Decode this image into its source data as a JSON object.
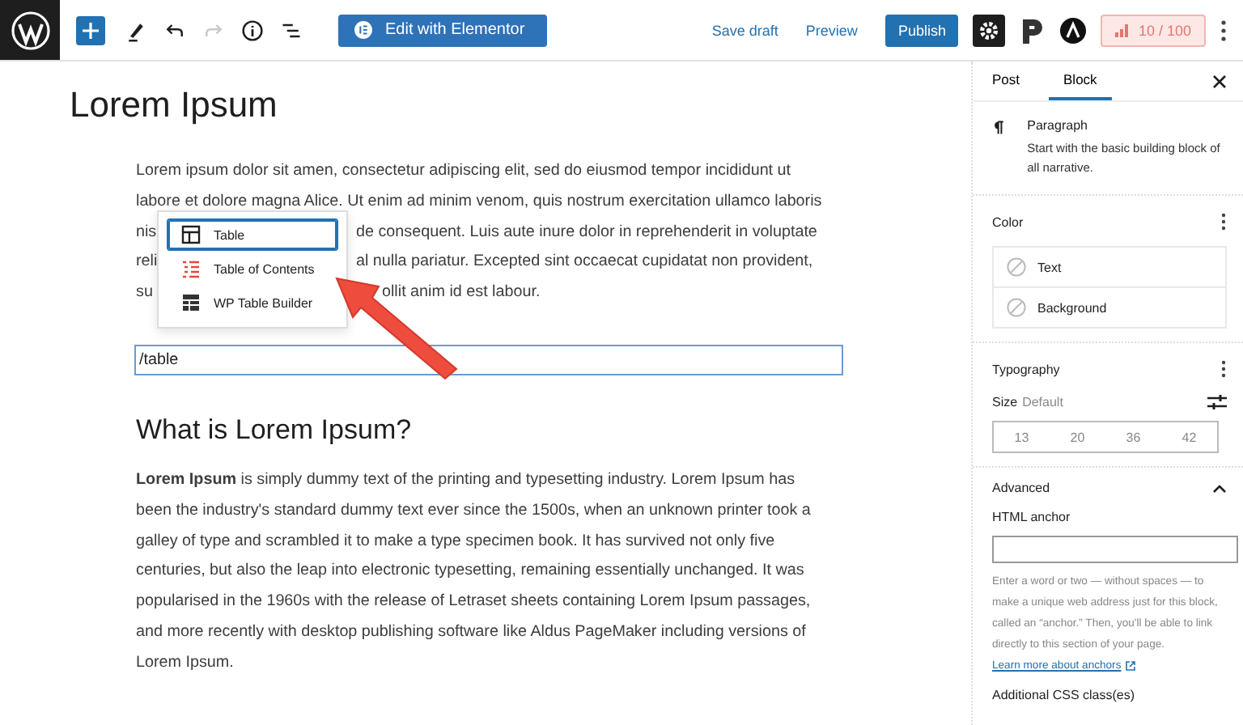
{
  "toolbar": {
    "tools": [
      {
        "kind": "add",
        "disabled": false
      },
      {
        "kind": "pen",
        "disabled": false
      },
      {
        "kind": "undo",
        "disabled": false
      },
      {
        "kind": "redo",
        "disabled": true
      },
      {
        "kind": "info",
        "disabled": false
      },
      {
        "kind": "list",
        "disabled": false
      }
    ],
    "elementor_button": "Edit with Elementor",
    "save_draft": "Save draft",
    "preview": "Preview",
    "publish": "Publish",
    "settings_selected": true,
    "score": "10 / 100"
  },
  "editor": {
    "title": "Lorem Ipsum",
    "intro_lines": [
      {
        "parts": [
          "Lorem ipsum dolor sit amen, consectetur adipiscing elit, sed do eiusmod tempor incididunt ut"
        ]
      },
      {
        "parts": [
          "labore et dolore magna Alice. Ut enim ad minim venom, quis nostrum exercitation ullamco laboris"
        ]
      },
      {
        "parts": [
          "nis",
          "de consequent. Luis aute inure dolor in reprehenderit in voluptate"
        ]
      },
      {
        "parts": [
          "reli",
          "al nulla pariatur. Excepted sint occaecat cupidatat non provident,"
        ]
      },
      {
        "parts": [
          "su",
          "ollit anim id est labour."
        ]
      }
    ],
    "inserter": [
      {
        "label": "Table",
        "kind": "table",
        "selected": true
      },
      {
        "label": "Table of Contents",
        "kind": "toc",
        "selected": false
      },
      {
        "label": "WP Table Builder",
        "kind": "builder",
        "selected": false
      }
    ],
    "slash_input": "/table",
    "heading": "What is Lorem Ipsum?",
    "paragraph": "**Lorem Ipsum** is simply dummy text of the printing and typesetting industry. Lorem Ipsum has been the industry's standard dummy text ever since the 1500s, when an unknown printer took a galley of type and scrambled it to make a type specimen book. It has survived not only five centuries, but also the leap into electronic typesetting, remaining essentially unchanged. It was popularised in the 1960s with the release of Letraset sheets containing Lorem Ipsum passages, and more recently with desktop publishing software like Aldus PageMaker including versions of Lorem Ipsum."
  },
  "sidebar": {
    "tabs": [
      {
        "label": "Post",
        "selected": false
      },
      {
        "label": "Block",
        "selected": true
      }
    ],
    "block": {
      "name": "Paragraph",
      "description": "Start with the basic building block of all narrative."
    },
    "color": {
      "title": "Color",
      "options": [
        "Text",
        "Background"
      ]
    },
    "typography": {
      "title": "Typography",
      "size_label": "Size",
      "size_value": "Default",
      "sizes": [
        "13",
        "20",
        "36",
        "42"
      ]
    },
    "advanced": {
      "title": "Advanced",
      "expanded": true,
      "anchor_label": "HTML anchor",
      "anchor_help": "Enter a word or two — without spaces — to make a unique web address just for this block, called an “anchor.” Then, you'll be able to link directly to this section of your page.",
      "anchor_link": "Learn more about anchors",
      "css_label": "Additional CSS class(es)"
    }
  }
}
